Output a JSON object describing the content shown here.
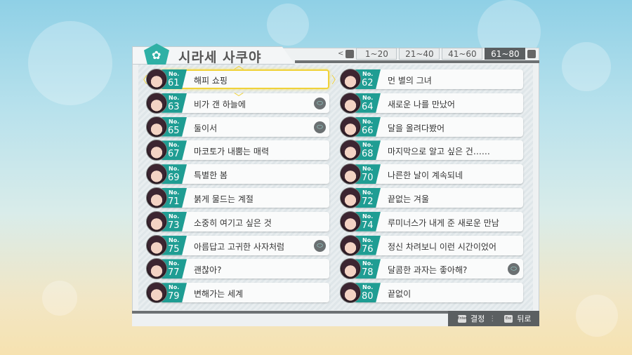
{
  "header": {
    "character_name": "시라세 사쿠야",
    "emblem_icon": "flower-emblem-icon"
  },
  "tabs": {
    "prev_key": "",
    "next_key": "",
    "items": [
      {
        "label": "1~20"
      },
      {
        "label": "21~40"
      },
      {
        "label": "41~60"
      },
      {
        "label": "61~80",
        "active": true
      }
    ]
  },
  "episodes": [
    {
      "no_label": "No.",
      "number": "61",
      "title": "해피 쇼핑",
      "selected": true,
      "memo": false
    },
    {
      "no_label": "No.",
      "number": "62",
      "title": "먼 별의 그녀",
      "memo": false
    },
    {
      "no_label": "No.",
      "number": "63",
      "title": "비가 갠 하늘에",
      "memo": true
    },
    {
      "no_label": "No.",
      "number": "64",
      "title": "새로운 나를 만났어",
      "memo": false
    },
    {
      "no_label": "No.",
      "number": "65",
      "title": "둘이서",
      "memo": true
    },
    {
      "no_label": "No.",
      "number": "66",
      "title": "달을 올려다봤어",
      "memo": false
    },
    {
      "no_label": "No.",
      "number": "67",
      "title": "마코토가 내뿜는 매력",
      "memo": false
    },
    {
      "no_label": "No.",
      "number": "68",
      "title": "마지막으로 알고 싶은 건……",
      "memo": false
    },
    {
      "no_label": "No.",
      "number": "69",
      "title": "특별한 봄",
      "memo": false
    },
    {
      "no_label": "No.",
      "number": "70",
      "title": "나른한 날이 계속되네",
      "memo": false
    },
    {
      "no_label": "No.",
      "number": "71",
      "title": "붉게 물드는 계절",
      "memo": false
    },
    {
      "no_label": "No.",
      "number": "72",
      "title": "끝없는 겨울",
      "memo": false
    },
    {
      "no_label": "No.",
      "number": "73",
      "title": "소중히 여기고 싶은 것",
      "memo": false
    },
    {
      "no_label": "No.",
      "number": "74",
      "title": "루미너스가 내게 준 새로운 만남",
      "memo": false
    },
    {
      "no_label": "No.",
      "number": "75",
      "title": "아름답고 고귀한 사자처럼",
      "memo": true
    },
    {
      "no_label": "No.",
      "number": "76",
      "title": "정신 차려보니 이런 시간이었어",
      "memo": false
    },
    {
      "no_label": "No.",
      "number": "77",
      "title": "괜찮아?",
      "memo": false
    },
    {
      "no_label": "No.",
      "number": "78",
      "title": "달콤한 과자는 좋아해?",
      "memo": true
    },
    {
      "no_label": "No.",
      "number": "79",
      "title": "변해가는 세계",
      "memo": false
    },
    {
      "no_label": "No.",
      "number": "80",
      "title": "끝없이",
      "memo": false
    }
  ],
  "footer": {
    "confirm_key": "Enter",
    "confirm_label": "결정",
    "back_key": "Esc",
    "back_label": "뒤로"
  }
}
